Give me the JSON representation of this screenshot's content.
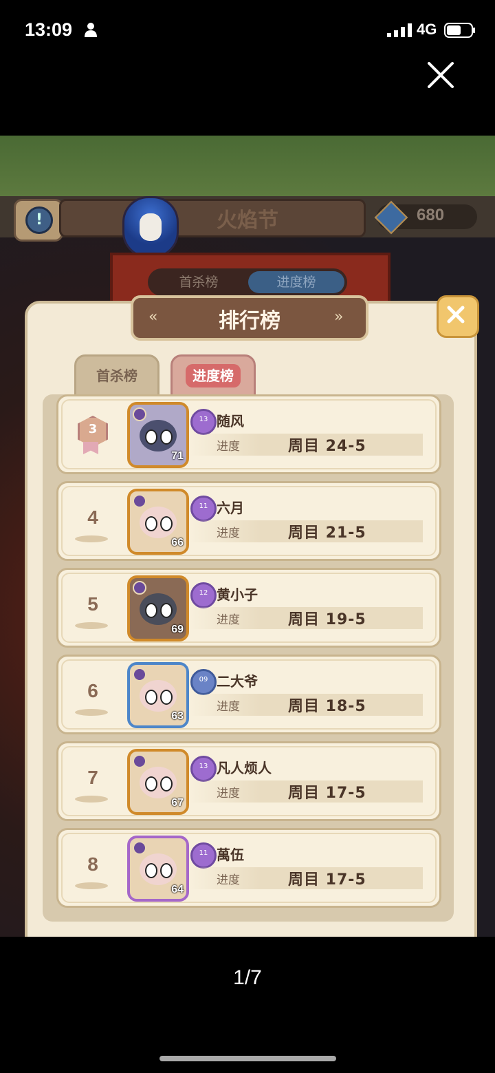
{
  "status_bar": {
    "time": "13:09",
    "network": "4G"
  },
  "game": {
    "festival_title": "火焰节",
    "currency": "680",
    "background_tabs": [
      "首杀榜",
      "进度榜"
    ]
  },
  "modal": {
    "title": "排行榜",
    "tabs": [
      {
        "label": "首杀榜",
        "active": false
      },
      {
        "label": "进度榜",
        "active": true
      }
    ],
    "progress_label": "进度",
    "rows": [
      {
        "rank": "3",
        "medal": true,
        "vip": "13",
        "name": "随风",
        "level": "71",
        "progress": "周目 24-5",
        "frame": "gold"
      },
      {
        "rank": "4",
        "medal": false,
        "vip": "11",
        "name": "六月",
        "level": "66",
        "progress": "周目 21-5",
        "frame": "gold"
      },
      {
        "rank": "5",
        "medal": false,
        "vip": "12",
        "name": "黄小子",
        "level": "69",
        "progress": "周目 19-5",
        "frame": "gold"
      },
      {
        "rank": "6",
        "medal": false,
        "vip": "09",
        "name": "二大爷",
        "level": "63",
        "progress": "周目 18-5",
        "frame": "blue"
      },
      {
        "rank": "7",
        "medal": false,
        "vip": "13",
        "name": "凡人烦人",
        "level": "67",
        "progress": "周目 17-5",
        "frame": "gold"
      },
      {
        "rank": "8",
        "medal": false,
        "vip": "11",
        "name": "萬伍",
        "level": "64",
        "progress": "周目 17-5",
        "frame": "purple"
      }
    ]
  },
  "viewer": {
    "page_indicator": "1/7"
  },
  "colors": {
    "modal_bg": "#f3ead6",
    "title_bar": "#7b5640",
    "active_tab": "#d66a6a",
    "close_button": "#f1c66d"
  }
}
